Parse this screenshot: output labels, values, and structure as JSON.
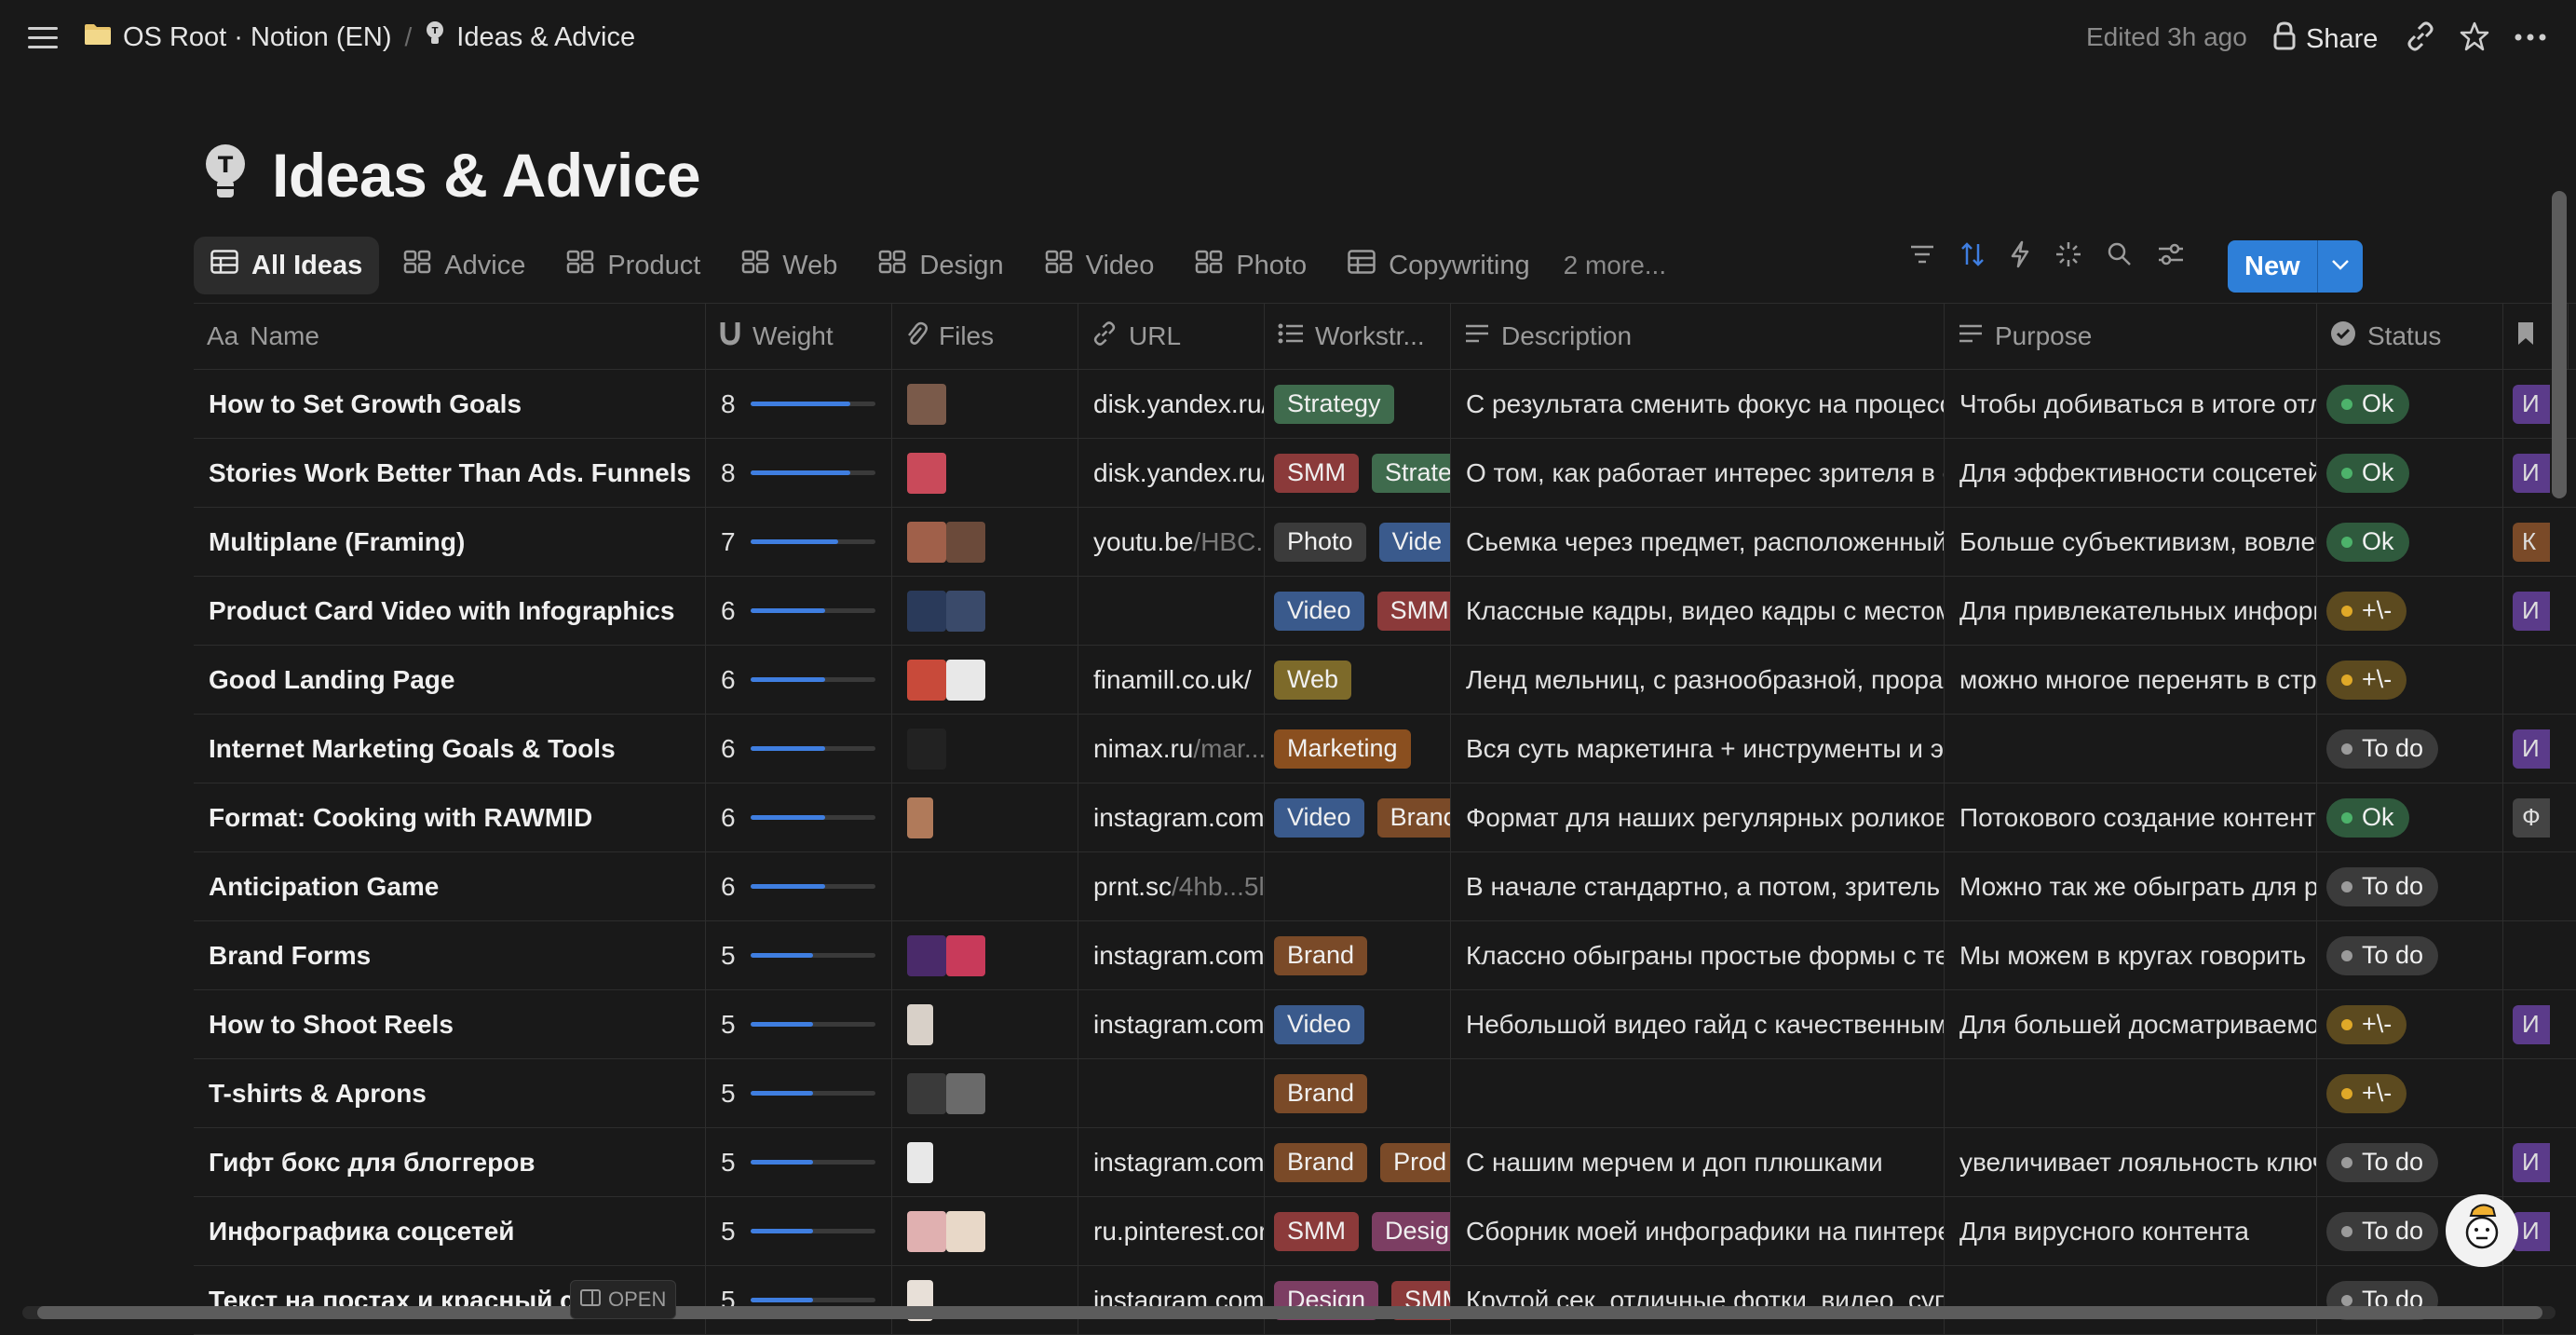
{
  "breadcrumb": {
    "workspace": "OS Root · Notion (EN)",
    "page": "Ideas & Advice"
  },
  "topbar": {
    "edited": "Edited 3h ago",
    "share": "Share"
  },
  "page": {
    "title": "Ideas & Advice"
  },
  "views": [
    {
      "label": "All Ideas",
      "active": true
    },
    {
      "label": "Advice"
    },
    {
      "label": "Product"
    },
    {
      "label": "Web"
    },
    {
      "label": "Design"
    },
    {
      "label": "Video"
    },
    {
      "label": "Photo"
    },
    {
      "label": "Copywriting"
    }
  ],
  "more_views": "2 more...",
  "new_button": "New",
  "columns": {
    "name": "Name",
    "weight": "Weight",
    "files": "Files",
    "url": "URL",
    "workstream": "Workstr...",
    "description": "Description",
    "purpose": "Purpose",
    "status": "Status"
  },
  "colors": {
    "accent": "#2e7fd8",
    "bar": "#3f7ee0",
    "tag_green": "#3f6b4d",
    "tag_red": "#8b3a3a",
    "tag_gray": "#3b3b3b",
    "tag_blue": "#3a5a8c",
    "tag_brown": "#7a4a28",
    "tag_yellow": "#7d6a2a",
    "tag_orange": "#8a4f1f",
    "tag_pink": "#7c3e63",
    "status_ok": "#2f5a3d",
    "status_mid": "#5c4a1f",
    "status_todo": "#3b3b3b",
    "dot_ok": "#4db36b",
    "dot_mid": "#e0a928",
    "dot_todo": "#9b9b9b"
  },
  "rows": [
    {
      "name": "How to Set Growth Goals",
      "weight": "8",
      "w": 0.8,
      "files": [
        "#7a5a4a"
      ],
      "url_dom": "disk.yandex.ru/",
      "url_path": "",
      "tags": [
        {
          "t": "Strategy",
          "c": "#3f6b4d"
        }
      ],
      "desc": "С результата сменить фокус на процесс",
      "purpose": "Чтобы добиваться в итоге отли",
      "status": "Ok",
      "st": "ok",
      "extra": "#5b3b8a",
      "extra_t": "И"
    },
    {
      "name": "Stories Work Better Than Ads. Funnels",
      "weight": "8",
      "w": 0.8,
      "files": [
        "#c94a5a"
      ],
      "url_dom": "disk.yandex.ru/",
      "url_path": "",
      "tags": [
        {
          "t": "SMM",
          "c": "#8b3a3a"
        },
        {
          "t": "Strate",
          "c": "#3f6b4d"
        }
      ],
      "desc": "О том, как работает интерес зрителя в со",
      "purpose": "Для эффективности соцсетей",
      "status": "Ok",
      "st": "ok",
      "extra": "#5b3b8a",
      "extra_t": "И"
    },
    {
      "name": "Multiplane (Framing)",
      "weight": "7",
      "w": 0.7,
      "files": [
        "#a0604a",
        "#6b4a3a"
      ],
      "url_dom": "youtu.be",
      "url_path": "/HBC...",
      "tags": [
        {
          "t": "Photo",
          "c": "#3b3b3b"
        },
        {
          "t": "Vide",
          "c": "#3a5a8c"
        }
      ],
      "desc": "Сьемка через предмет, расположенный",
      "purpose": "Больше субъективизм, вовлеч",
      "status": "Ok",
      "st": "ok",
      "extra": "#7a4a28",
      "extra_t": "К"
    },
    {
      "name": "Product Card Video with Infographics",
      "weight": "6",
      "w": 0.6,
      "files": [
        "#2a3a5a",
        "#3a4a6a"
      ],
      "url_dom": "",
      "url_path": "",
      "tags": [
        {
          "t": "Video",
          "c": "#3a5a8c"
        },
        {
          "t": "SMM",
          "c": "#8b3a3a"
        }
      ],
      "desc": "Классные кадры, видео кадры с местом",
      "purpose": "Для привлекательных информ",
      "status": "+\\-",
      "st": "mid",
      "extra": "#5b3b8a",
      "extra_t": "И"
    },
    {
      "name": "Good Landing Page",
      "weight": "6",
      "w": 0.6,
      "files": [
        "#c84a3a",
        "#e8e8e8"
      ],
      "url_dom": "finamill.co.uk/",
      "url_path": "",
      "tags": [
        {
          "t": "Web",
          "c": "#7d6a2a"
        }
      ],
      "desc": "Ленд мельниц, с разнообразной, прораб",
      "purpose": "можно многое перенять в стр",
      "status": "+\\-",
      "st": "mid",
      "extra": "",
      "extra_t": ""
    },
    {
      "name": "Internet Marketing Goals & Tools",
      "weight": "6",
      "w": 0.6,
      "files": [
        "#222222"
      ],
      "url_dom": "nimax.ru",
      "url_path": "/mar...",
      "tags": [
        {
          "t": "Marketing",
          "c": "#8a4f1f"
        }
      ],
      "desc": "Вся суть маркетинга + инструменты и эф",
      "purpose": "",
      "status": "To do",
      "st": "todo",
      "extra": "#5b3b8a",
      "extra_t": "И"
    },
    {
      "name": "Format: Cooking with RAWMID",
      "weight": "6",
      "w": 0.6,
      "files": [
        "#b07a5a"
      ],
      "url_dom": "instagram.com",
      "url_path": "",
      "tags": [
        {
          "t": "Video",
          "c": "#3a5a8c"
        },
        {
          "t": "Branc",
          "c": "#7a4a28"
        }
      ],
      "desc": "Формат для наших регулярных роликов,",
      "purpose": "Потокового создание контент",
      "status": "Ok",
      "st": "ok",
      "extra": "#444444",
      "extra_t": "Ф"
    },
    {
      "name": "Anticipation Game",
      "weight": "6",
      "w": 0.6,
      "files": [],
      "url_dom": "prnt.sc",
      "url_path": "/4hb...5l",
      "tags": [],
      "desc": "В начале стандартно, а потом, зритель ж",
      "purpose": "Можно так же обыграть для ре",
      "status": "To do",
      "st": "todo",
      "extra": "",
      "extra_t": ""
    },
    {
      "name": "Brand Forms",
      "weight": "5",
      "w": 0.5,
      "files": [
        "#4a2a6a",
        "#c83a5a"
      ],
      "url_dom": "instagram.com",
      "url_path": "",
      "tags": [
        {
          "t": "Brand",
          "c": "#7a4a28"
        }
      ],
      "desc": "Классно обыграны простые формы с тек",
      "purpose": "Мы можем в кругах говорить",
      "status": "To do",
      "st": "todo",
      "extra": "",
      "extra_t": ""
    },
    {
      "name": "How to Shoot Reels",
      "weight": "5",
      "w": 0.5,
      "files": [
        "#d8d0c8"
      ],
      "url_dom": "instagram.com",
      "url_path": "",
      "tags": [
        {
          "t": "Video",
          "c": "#3a5a8c"
        }
      ],
      "desc": "Небольшой видео гайд с качественными",
      "purpose": "Для большей досматриваемос",
      "status": "+\\-",
      "st": "mid",
      "extra": "#5b3b8a",
      "extra_t": "И"
    },
    {
      "name": "T-shirts & Aprons",
      "weight": "5",
      "w": 0.5,
      "files": [
        "#3a3a3a",
        "#6a6a6a"
      ],
      "url_dom": "",
      "url_path": "",
      "tags": [
        {
          "t": "Brand",
          "c": "#7a4a28"
        }
      ],
      "desc": "",
      "purpose": "",
      "status": "+\\-",
      "st": "mid",
      "extra": "",
      "extra_t": ""
    },
    {
      "name": "Гифт бокс для блоггеров",
      "weight": "5",
      "w": 0.5,
      "files": [
        "#e8e8e8"
      ],
      "url_dom": "instagram.com",
      "url_path": "",
      "tags": [
        {
          "t": "Brand",
          "c": "#7a4a28"
        },
        {
          "t": "Prod",
          "c": "#7a4a28"
        }
      ],
      "desc": "С нашим мерчем и доп плюшками",
      "purpose": "увеличивает лояльность ключ",
      "status": "To do",
      "st": "todo",
      "extra": "#5b3b8a",
      "extra_t": "И"
    },
    {
      "name": "Инфографика соцсетей",
      "weight": "5",
      "w": 0.5,
      "files": [
        "#e0b0b0",
        "#e8d8c8"
      ],
      "url_dom": "ru.pinterest.cor",
      "url_path": "",
      "tags": [
        {
          "t": "SMM",
          "c": "#8b3a3a"
        },
        {
          "t": "Desig",
          "c": "#7c3e63"
        }
      ],
      "desc": "Сборник моей инфографики на пинтере",
      "purpose": "Для вирусного контента",
      "status": "To do",
      "st": "todo",
      "extra": "#5b3b8a",
      "extra_t": "И"
    },
    {
      "name": "Текст на постах и красный с",
      "weight": "5",
      "w": 0.5,
      "files": [
        "#e8e0d8"
      ],
      "url_dom": "instagram.com",
      "url_path": "",
      "tags": [
        {
          "t": "Design",
          "c": "#7c3e63"
        },
        {
          "t": "SMM",
          "c": "#8b3a3a"
        }
      ],
      "desc": "Крутой сек, отличные фотки, видео, суп",
      "purpose": "",
      "status": "To do",
      "st": "todo",
      "extra": "",
      "extra_t": ""
    }
  ],
  "open_button": "OPEN"
}
